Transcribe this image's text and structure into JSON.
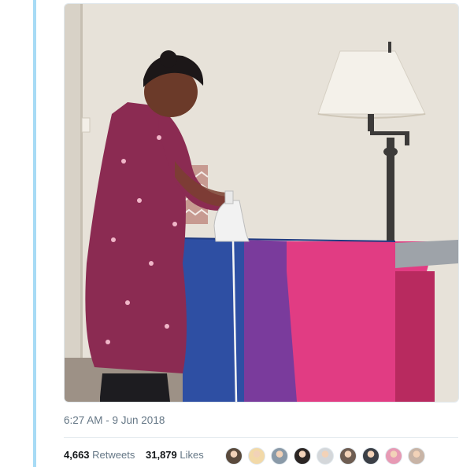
{
  "tweet": {
    "media_alt": "photo",
    "timestamp": "6:27 AM - 9 Jun 2018",
    "stats": {
      "retweets_count": "4,663",
      "retweets_label": "Retweets",
      "likes_count": "31,879",
      "likes_label": "Likes"
    },
    "likers": [
      {
        "icon": "user-avatar-icon",
        "color": "#5a4a3c"
      },
      {
        "icon": "user-avatar-icon",
        "color": "#f2d9a8"
      },
      {
        "icon": "user-avatar-icon",
        "color": "#8a9aa8"
      },
      {
        "icon": "user-avatar-icon",
        "color": "#2b2523"
      },
      {
        "icon": "user-avatar-icon",
        "color": "#d4d7da"
      },
      {
        "icon": "user-avatar-icon",
        "color": "#6e5d52"
      },
      {
        "icon": "user-avatar-icon",
        "color": "#3b3f46"
      },
      {
        "icon": "user-avatar-icon",
        "color": "#e79ab4"
      },
      {
        "icon": "user-avatar-icon",
        "color": "#c8b4a6"
      }
    ]
  },
  "colors": {
    "thread_line": "#a7dbf5",
    "text_secondary": "#657786",
    "text_primary": "#14171a",
    "flag_blue": "#2e4fa3",
    "flag_purple": "#7a3b9c",
    "flag_pink": "#e13c83"
  }
}
